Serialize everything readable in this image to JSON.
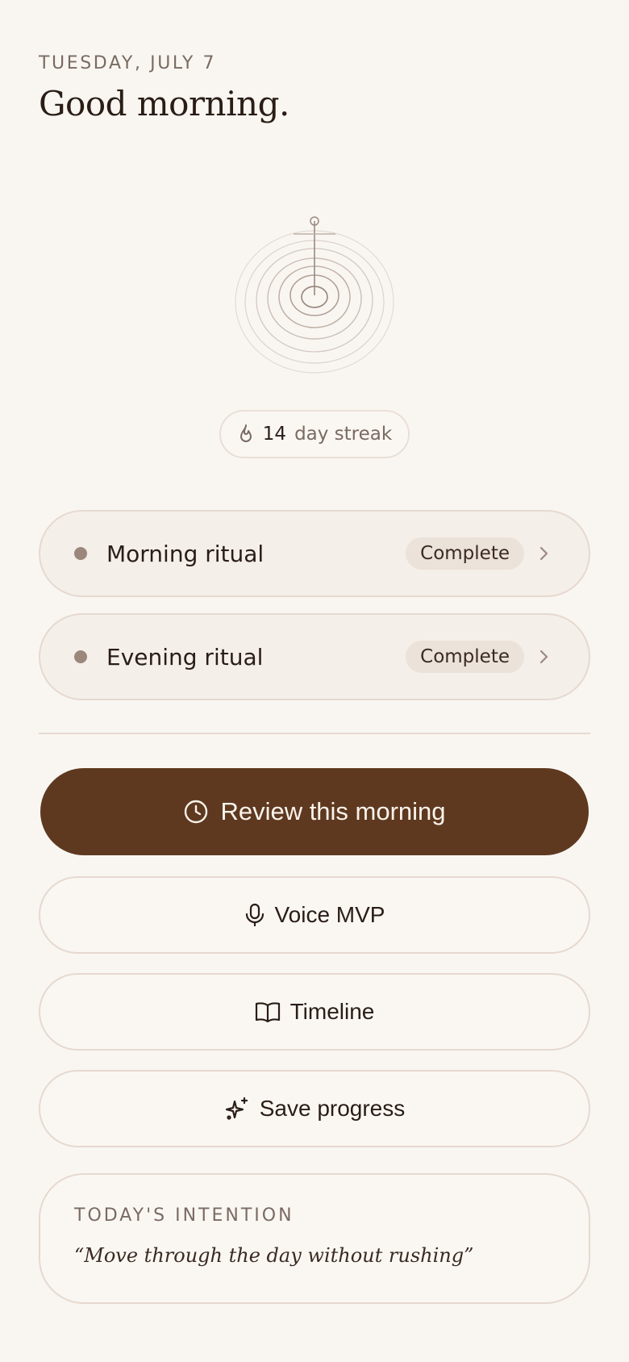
{
  "header": {
    "date": "TUESDAY, JULY 7",
    "greeting": "Good morning."
  },
  "emblem": {
    "icon": "ripple-emblem-icon"
  },
  "streak": {
    "count": "14",
    "label": "day streak",
    "icon": "flame-icon"
  },
  "rituals": [
    {
      "label": "Morning ritual",
      "status": "Complete"
    },
    {
      "label": "Evening ritual",
      "status": "Complete"
    }
  ],
  "actions": {
    "primary": {
      "label": "Review this morning",
      "icon": "clock-icon"
    },
    "voice": {
      "label": "Voice MVP",
      "icon": "microphone-icon"
    },
    "timeline": {
      "label": "Timeline",
      "icon": "book-icon"
    },
    "save": {
      "label": "Save progress",
      "icon": "sparkles-icon"
    }
  },
  "intention": {
    "heading": "TODAY'S INTENTION",
    "quote": "“Move through the day without rushing”"
  },
  "colors": {
    "background": "#f9f6f2",
    "primary_button": "#5e3920",
    "accent_dot": "#9c877c",
    "border": "#e6d9cf"
  }
}
